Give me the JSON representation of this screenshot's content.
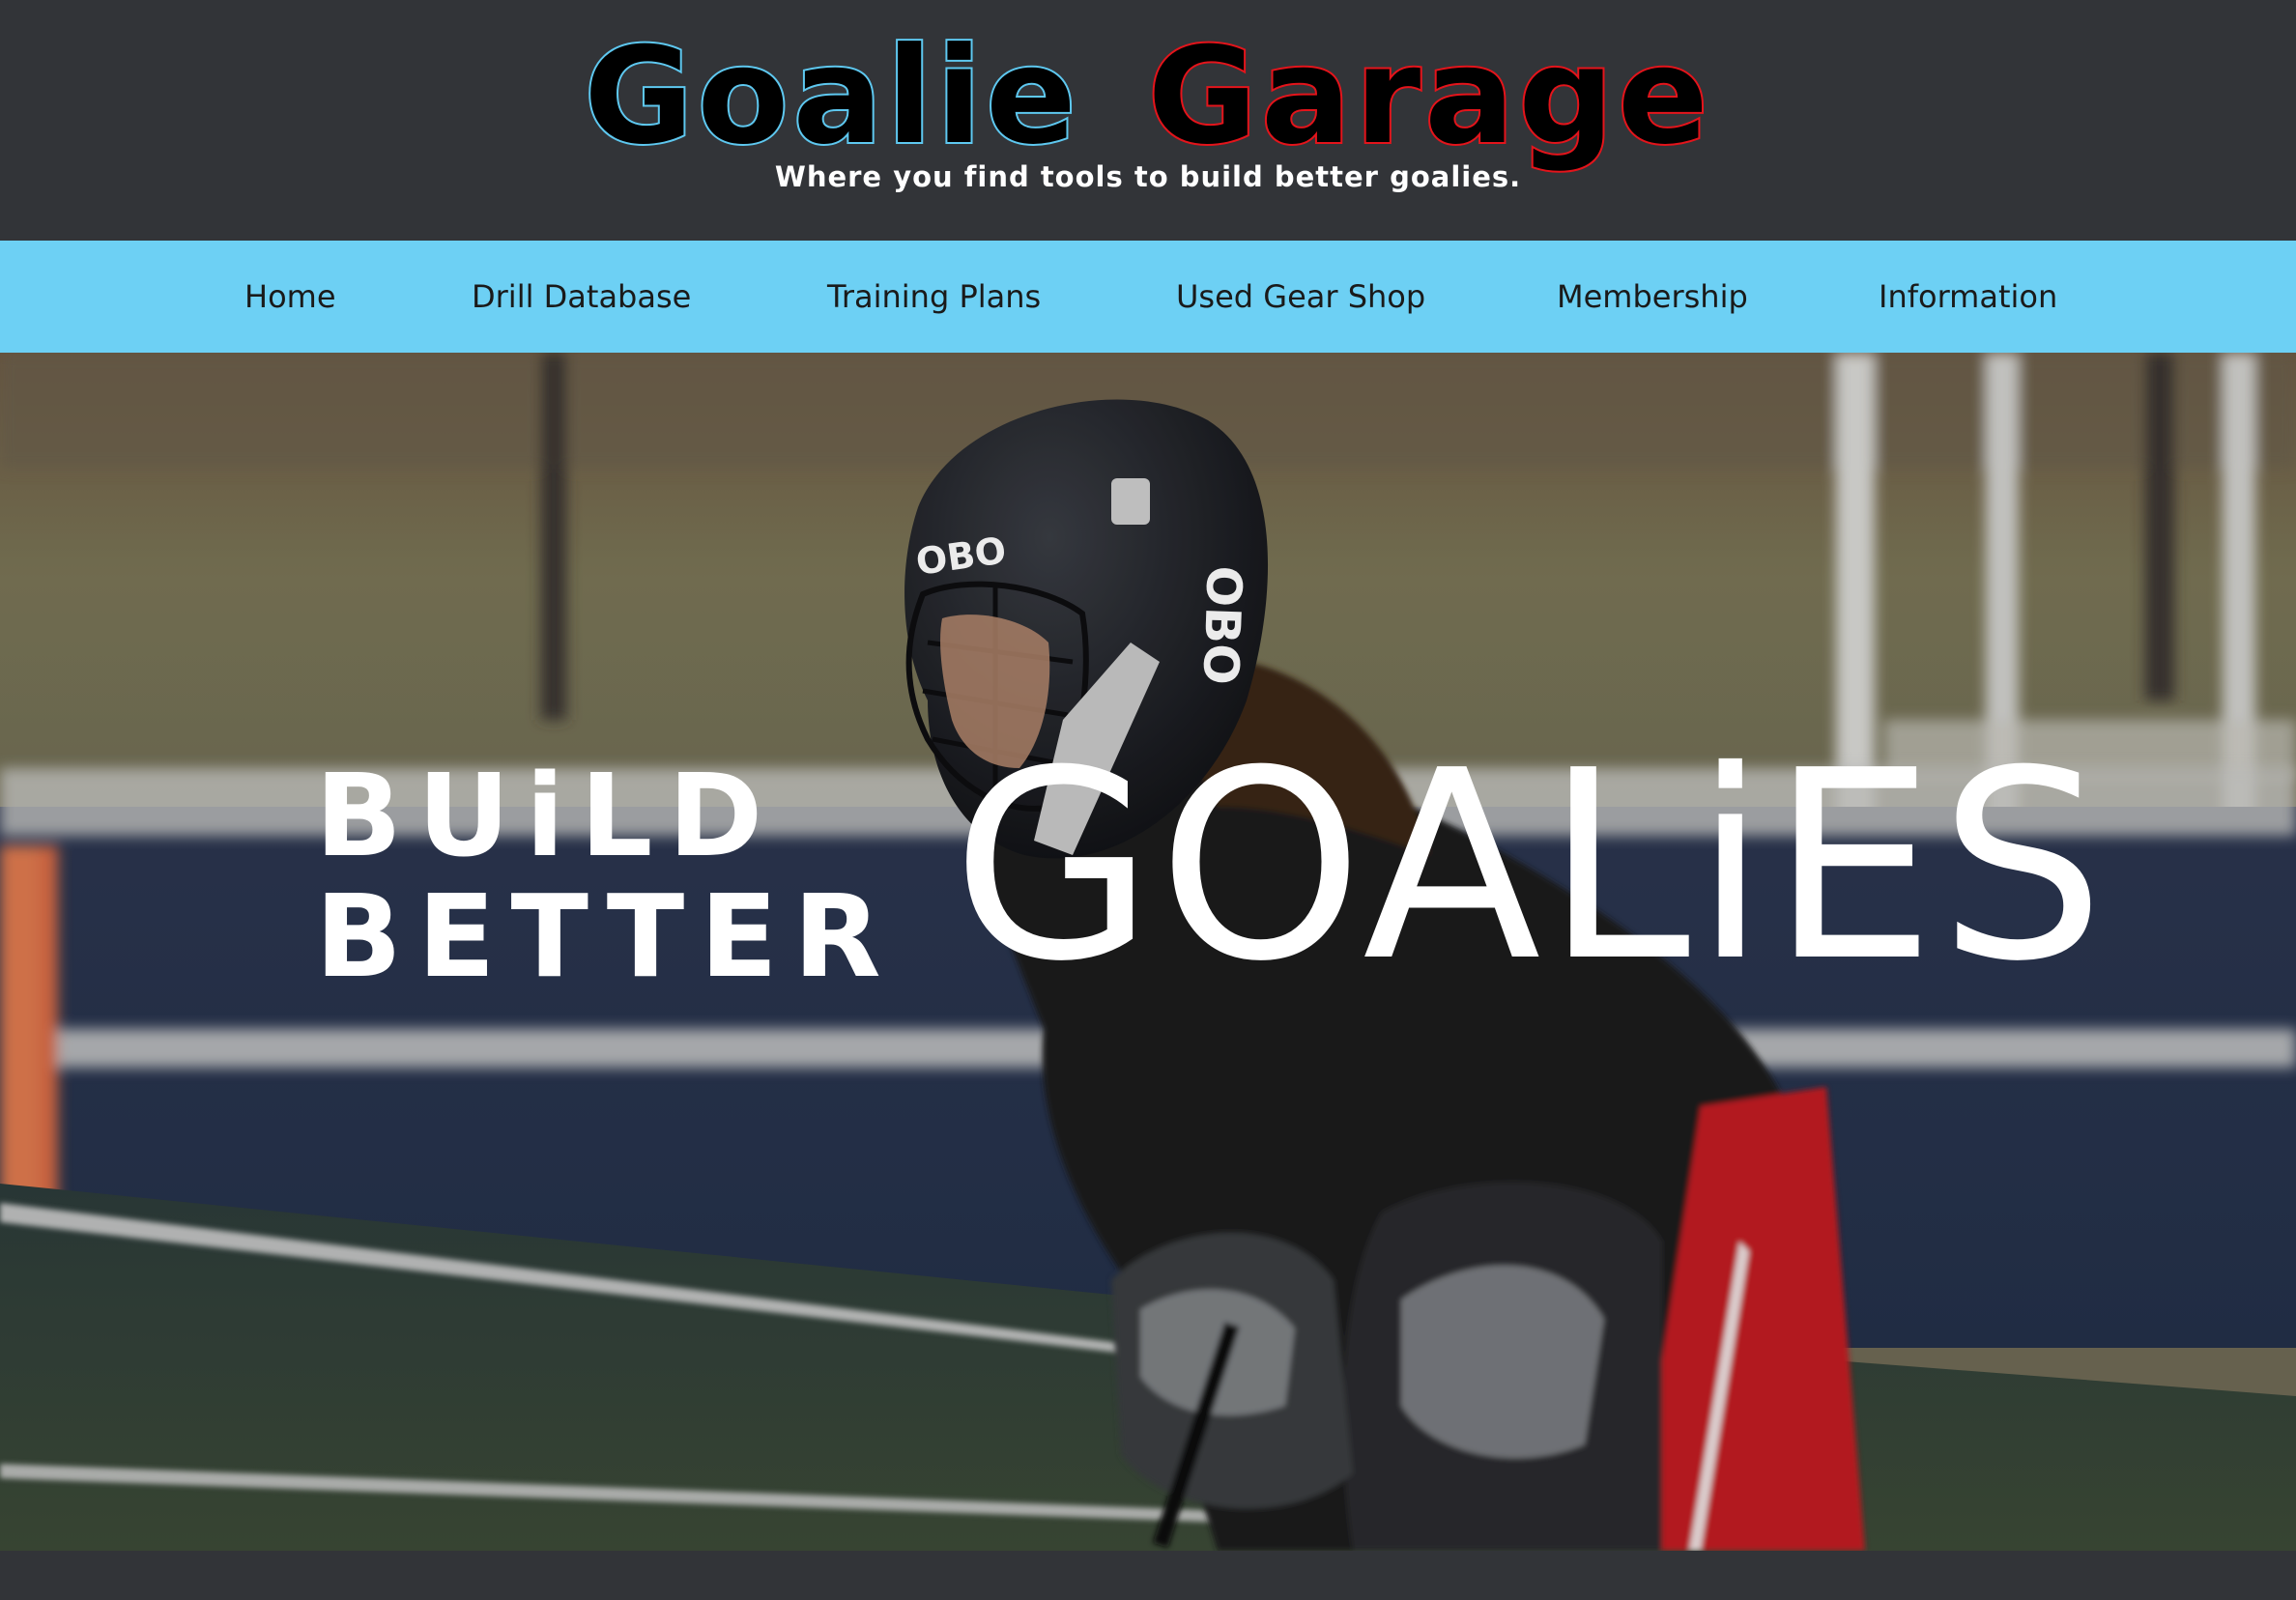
{
  "header": {
    "logo_part1": "Goalie",
    "logo_part2": "Garage",
    "tagline": "Where you find tools to build better goalies."
  },
  "nav": {
    "items": [
      {
        "label": "Home"
      },
      {
        "label": "Drill Database"
      },
      {
        "label": "Training Plans"
      },
      {
        "label": "Used Gear Shop"
      },
      {
        "label": "Membership"
      },
      {
        "label": "Information"
      }
    ]
  },
  "hero": {
    "headline_line1": "BUiLD",
    "headline_line2": "BETTER",
    "headline_big": "GOALiES",
    "helmet_brand": "OBO"
  },
  "colors": {
    "page_bg": "#323438",
    "nav_bg": "#6dd0f4",
    "logo_accent_blue": "#5ec8f0",
    "logo_accent_red": "#e4141b"
  }
}
